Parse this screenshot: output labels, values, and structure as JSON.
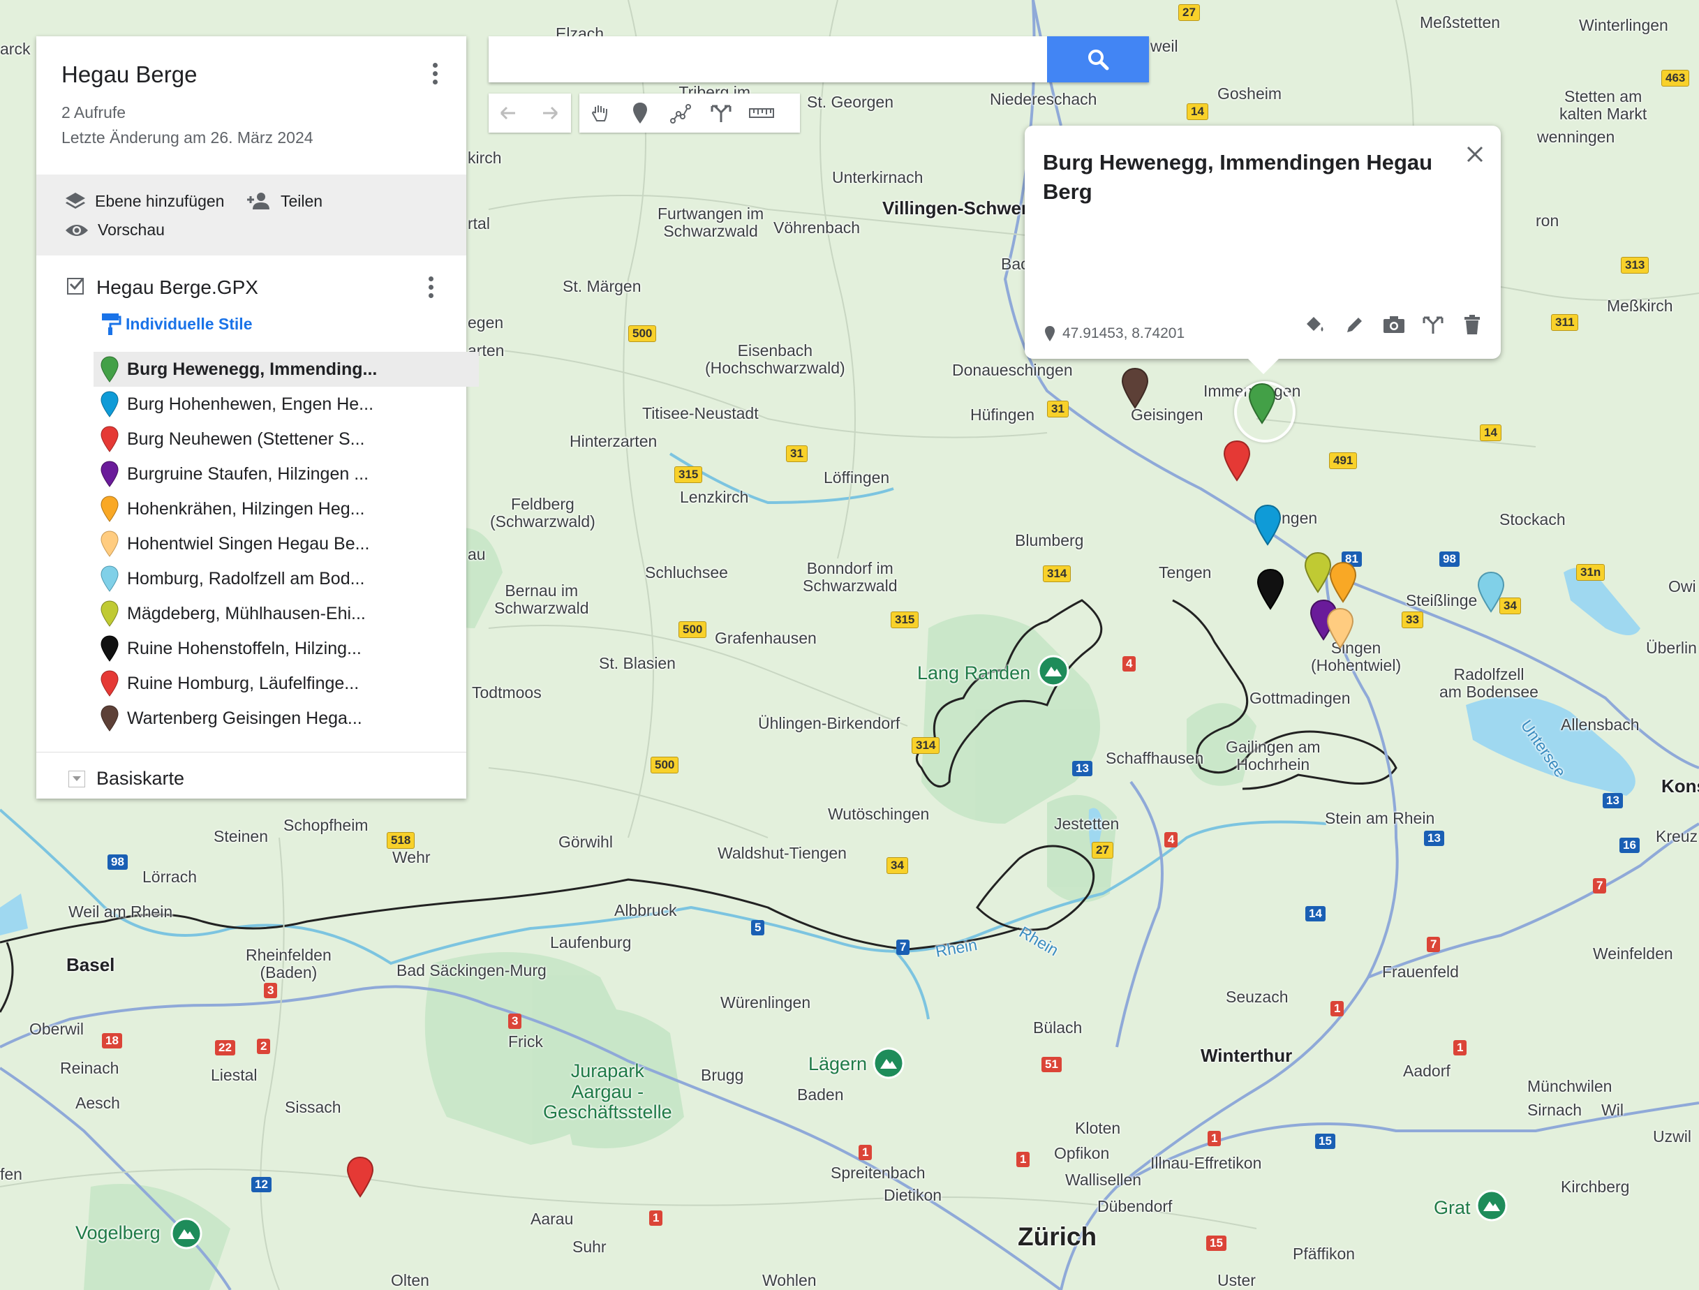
{
  "map": {
    "labels": {
      "zuerich": "Zürich",
      "winterthur": "Winterthur",
      "schaffhausen": "Schaffhausen",
      "singen": "Singen\n(Hohentwiel)",
      "villingen": "Villingen-Schwenn",
      "basel": "Basel",
      "tengen": "Tengen",
      "blumberg": "Blumberg",
      "geisingen": "Geisingen",
      "huefingen": "Hüfingen",
      "donaueschingen": "Donaueschingen",
      "immendingen": "Immendingen",
      "engen": "ngen",
      "stockach": "Stockach",
      "radolfzell": "Radolfzell\nam Bodensee",
      "gottmadingen": "Gottmadingen",
      "allensbach": "Allensbach",
      "steisslingen": "Steißlinge",
      "stein": "Stein am Rhein",
      "jestetten": "Jestetten",
      "gailingen": "Gailingen am\nHochrhein",
      "frauenfeld": "Frauenfeld",
      "weinfelden": "Weinfelden",
      "seuzach": "Seuzach",
      "buelach": "Bülach",
      "kloten": "Kloten",
      "opfikon": "Opfikon",
      "wallisellen": "Wallisellen",
      "duebendorf": "Dübendorf",
      "illnau": "Illnau-Effretikon",
      "pfaeffikon": "Pfäffikon",
      "uster": "Uster",
      "aadorf": "Aadorf",
      "muenchwilen": "Münchwilen",
      "sirnach": "Sirnach",
      "wil": "Wil",
      "uzwil": "Uzwil",
      "kirchberg": "Kirchberg",
      "grat": "Grat",
      "dietikon": "Dietikon",
      "spreitenbach": "Spreitenbach",
      "baden": "Baden",
      "laegern": "Lägern",
      "brugg": "Brugg",
      "wuerenlingen": "Würenlingen",
      "frick": "Frick",
      "jurapark": "Jurapark\nAargau -\nGeschäftsstelle",
      "aarau": "Aarau",
      "suhr": "Suhr",
      "wohlen": "Wohlen",
      "olten": "Olten",
      "sissach": "Sissach",
      "liestal": "Liestal",
      "reinach": "Reinach",
      "aesch": "Aesch",
      "oberwil": "Oberwil",
      "vogelberg": "Vogelberg",
      "rheinfelden": "Rheinfelden\n(Baden)",
      "badsaeckingen": "Bad Säckingen-Murg",
      "laufenburg": "Laufenburg",
      "albbruck": "Albbruck",
      "waldshut": "Waldshut-Tiengen",
      "goerwihl": "Görwihl",
      "wehr": "Wehr",
      "schopfheim": "Schopfheim",
      "steinen": "Steinen",
      "loerrach": "Lörrach",
      "weilamrhein": "Weil am Rhein",
      "wutoeschingen": "Wutöschingen",
      "uehlingen": "Ühlingen-Birkendorf",
      "langranden": "Lang Randen",
      "todtmoos": "Todtmoos",
      "stblasien": "St. Blasien",
      "grafenhausen": "Grafenhausen",
      "bernau": "Bernau im\nSchwarzwald",
      "schluchsee": "Schluchsee",
      "bonndorf": "Bonndorf im\nSchwarzwald",
      "feldberg": "Feldberg\n(Schwarzwald)",
      "lenzkirch": "Lenzkirch",
      "loeffingen": "Löffingen",
      "hinterzarten": "Hinterzarten",
      "titisee": "Titisee-Neustadt",
      "eisenbach": "Eisenbach\n(Hochschwarzwald)",
      "stmaergen": "St. Märgen",
      "furtwangen": "Furtwangen im\nSchwarzwald",
      "voehrenbach": "Vöhrenbach",
      "unterkirnach": "Unterkirnach",
      "niedereschach": "Niedereschach",
      "stgeorgen": "St. Georgen",
      "triberg": "Triberg im\nSchwarzwald",
      "gosheim": "Gosheim",
      "messstetten": "Meßstetten",
      "winterlingen": "Winterlingen",
      "stetten": "Stetten am\nkalten Markt",
      "messkirch": "Meßkirch",
      "weil": "weil",
      "kirch": "kirch",
      "rtal": "rtal",
      "egen": "egen",
      "arten": "arten",
      "au": "au",
      "marck": "arck",
      "bac": "Bac",
      "ron": "ron",
      "wenningen": "wenningen",
      "uberlin": "Überlin",
      "owi": "Owi",
      "kons": "Kons",
      "kreuz": "Kreuz",
      "elzach": "Elzach",
      "fen": "fen",
      "untersee": "Untersee",
      "rhein": "Rhein"
    },
    "shields": [
      "27",
      "463",
      "14",
      "313",
      "311",
      "31",
      "491",
      "14",
      "98",
      "31n",
      "81",
      "33",
      "34",
      "315",
      "31",
      "500",
      "500",
      "315",
      "314",
      "314",
      "13",
      "13",
      "4",
      "4",
      "27",
      "34",
      "518",
      "98",
      "500",
      "5",
      "7",
      "14",
      "7",
      "7",
      "1",
      "1",
      "1",
      "51",
      "1",
      "1",
      "1",
      "15",
      "15",
      "16",
      "13",
      "3",
      "3",
      "2",
      "22",
      "18",
      "12"
    ]
  },
  "panel": {
    "map_title": "Hegau Berge",
    "views": "2 Aufrufe",
    "last_modified": "Letzte Änderung am 26. März 2024",
    "add_layer": "Ebene hinzufügen",
    "share": "Teilen",
    "preview": "Vorschau",
    "layer_name": "Hegau Berge.GPX",
    "styles_link": "Individuelle Stile",
    "items": [
      {
        "label": "Burg Hewenegg, Immending...",
        "color": "#43a047"
      },
      {
        "label": "Burg Hohenhewen, Engen He...",
        "color": "#0f9bd7"
      },
      {
        "label": "Burg Neuhewen (Stettener S...",
        "color": "#e53935"
      },
      {
        "label": "Burgruine Staufen, Hilzingen ...",
        "color": "#6a1b9a"
      },
      {
        "label": "Hohenkrähen, Hilzingen Heg...",
        "color": "#f9a825"
      },
      {
        "label": "Hohentwiel Singen Hegau Be...",
        "color": "#ffcc80"
      },
      {
        "label": "Homburg, Radolfzell am Bod...",
        "color": "#80d0e8"
      },
      {
        "label": "Mägdeberg, Mühlhausen-Ehi...",
        "color": "#c0ca33"
      },
      {
        "label": "Ruine Hohenstoffeln, Hilzing...",
        "color": "#111111"
      },
      {
        "label": "Ruine Homburg, Läufelfinge...",
        "color": "#e53935"
      },
      {
        "label": "Wartenberg Geisingen Hega...",
        "color": "#5d4037"
      }
    ],
    "basemap": "Basiskarte"
  },
  "search": {
    "placeholder": "",
    "value": ""
  },
  "info_window": {
    "title": "Burg Hewenegg, Immendingen Hegau Berg",
    "coordinates": "47.91453, 8.74201"
  },
  "colors": {
    "search_button": "#4285f4",
    "link": "#1a73e8",
    "water": "#9fd8f0",
    "green": "#b4dfb4"
  }
}
